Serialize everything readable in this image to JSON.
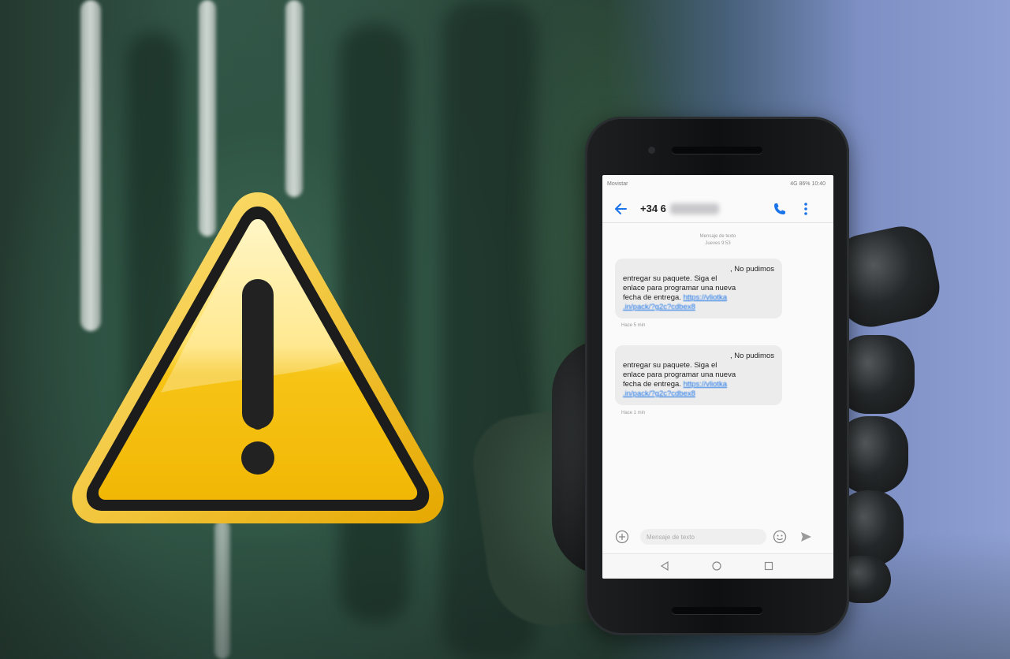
{
  "scene": {
    "description_icons": [
      "warning-icon"
    ],
    "colors": {
      "warning_yellow": "#f7c21b",
      "warning_border": "#1c1c1c",
      "hoodie_green": "#34584a",
      "background_blue": "#8e9fd3"
    }
  },
  "phone": {
    "status": {
      "carrier": "Movistar",
      "right": "4G 86% 10:40"
    },
    "header": {
      "number_prefix": "+34 6"
    },
    "thread_meta": {
      "line1": "Mensaje de texto",
      "line2": "Jueves 9:53"
    },
    "messages": [
      {
        "first_line": ", No pudimos",
        "body_lines": [
          "entregar su paquete. Siga el",
          "enlace para programar una nueva",
          "fecha de entrega."
        ],
        "link_part1": "https://vliotka",
        "link_part2": ".in/pack/?g2c?cdbex8",
        "time": "Hace 5 min"
      },
      {
        "first_line": ", No pudimos",
        "body_lines": [
          "entregar su paquete. Siga el",
          "enlace para programar una nueva",
          "fecha de entrega."
        ],
        "link_part1": "https://vliotka",
        "link_part2": ".in/pack/?g2c?cdbex8",
        "time": "Hace 1 min"
      }
    ],
    "composer": {
      "placeholder": "Mensaje de texto"
    }
  }
}
